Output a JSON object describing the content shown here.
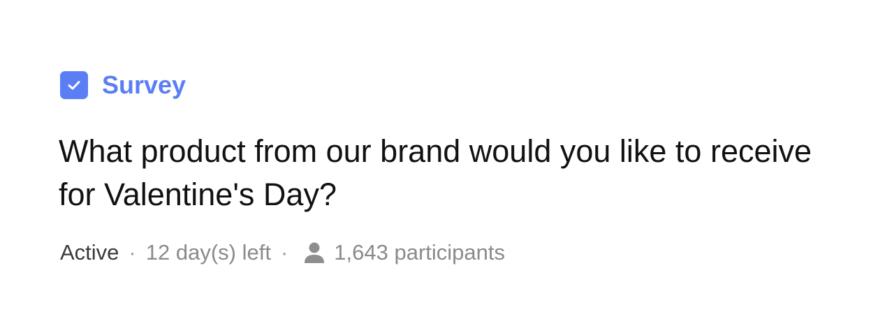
{
  "post": {
    "type_icon": "checkbox-checked-icon",
    "type_label": "Survey",
    "accent_color": "#5b7ef5",
    "title": "What product from our brand would you like to receive for Valentine's Day?",
    "meta": {
      "status": "Active",
      "separator": "·",
      "time_left": "12 day(s) left",
      "participants_icon": "person-icon",
      "participants": "1,643 participants"
    }
  }
}
